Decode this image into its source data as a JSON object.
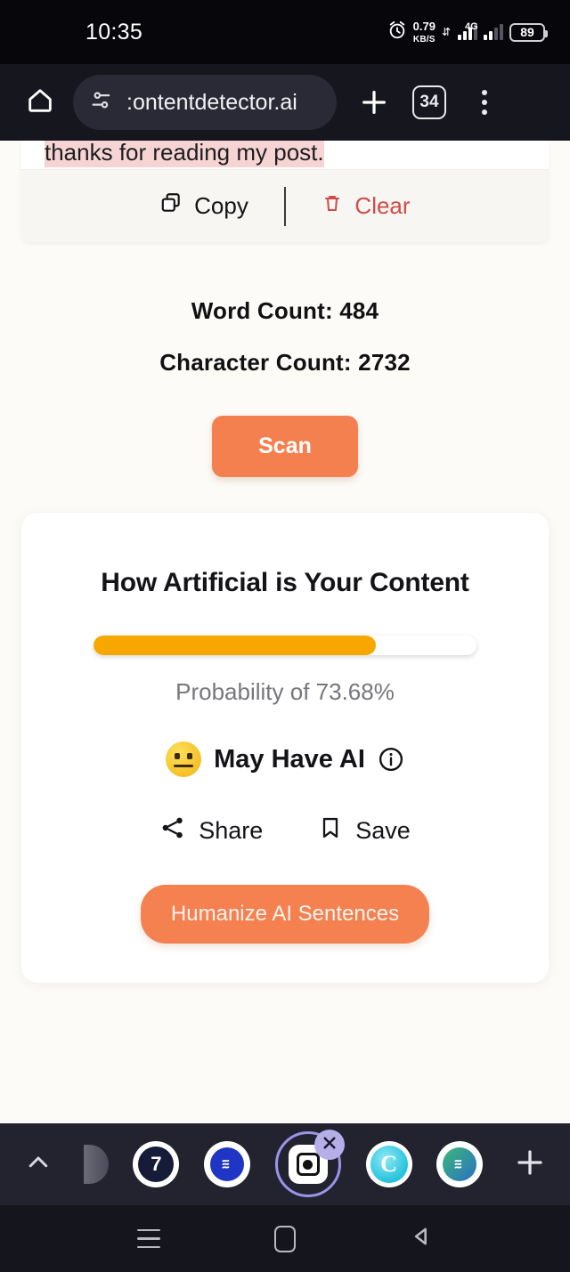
{
  "status_bar": {
    "time": "10:35",
    "alarm_icon": "alarm-clock-icon",
    "network_speed_value": "0.79",
    "network_speed_unit": "KB/S",
    "network_type": "4G",
    "network_type_suffix": "+",
    "battery_level": "89"
  },
  "browser": {
    "home_icon": "home-icon",
    "page_info_icon": "page-info-sliders-icon",
    "url": "contentdetector.ai",
    "url_display": ":ontentdetector.ai",
    "new_tab_icon": "plus-icon",
    "tab_count": "34",
    "menu_icon": "kebab-menu-icon"
  },
  "page": {
    "editor_snippet": "thanks for reading my post.",
    "actions": {
      "copy_label": "Copy",
      "copy_icon": "copy-icon",
      "clear_label": "Clear",
      "clear_icon": "trash-icon",
      "clear_color": "#cf4c47"
    },
    "word_count_label": "Word Count: 484",
    "character_count_label": "Character Count: 2732",
    "scan_button": "Scan",
    "scan_button_color": "#f5804f",
    "result": {
      "title": "How Artificial is Your Content",
      "probability_percent": 73.68,
      "probability_label": "Probability of 73.68%",
      "progress_color": "#f7a800",
      "verdict_emoji": "neutral-face-emoji",
      "verdict_label": "May Have AI",
      "info_icon": "info-circle-icon",
      "share_label": "Share",
      "share_icon": "share-nodes-icon",
      "save_label": "Save",
      "save_icon": "bookmark-icon",
      "humanize_button": "Humanize AI Sentences",
      "humanize_button_color": "#f58050"
    }
  },
  "tab_strip": {
    "expand_icon": "chevron-up-icon",
    "tabs": [
      {
        "name": "tab-favicon-seven",
        "badge": "7"
      },
      {
        "name": "tab-favicon-steemit-blue",
        "badge": ""
      },
      {
        "name": "tab-favicon-active",
        "badge": ""
      },
      {
        "name": "tab-favicon-cyan-c",
        "badge": "C"
      },
      {
        "name": "tab-favicon-steemit-green",
        "badge": ""
      }
    ],
    "close_icon": "close-x-icon",
    "add_tab_icon": "plus-icon"
  },
  "nav_bar": {
    "recents_icon": "recents-hamburger-icon",
    "home_icon": "home-square-icon",
    "back_icon": "back-triangle-icon"
  }
}
